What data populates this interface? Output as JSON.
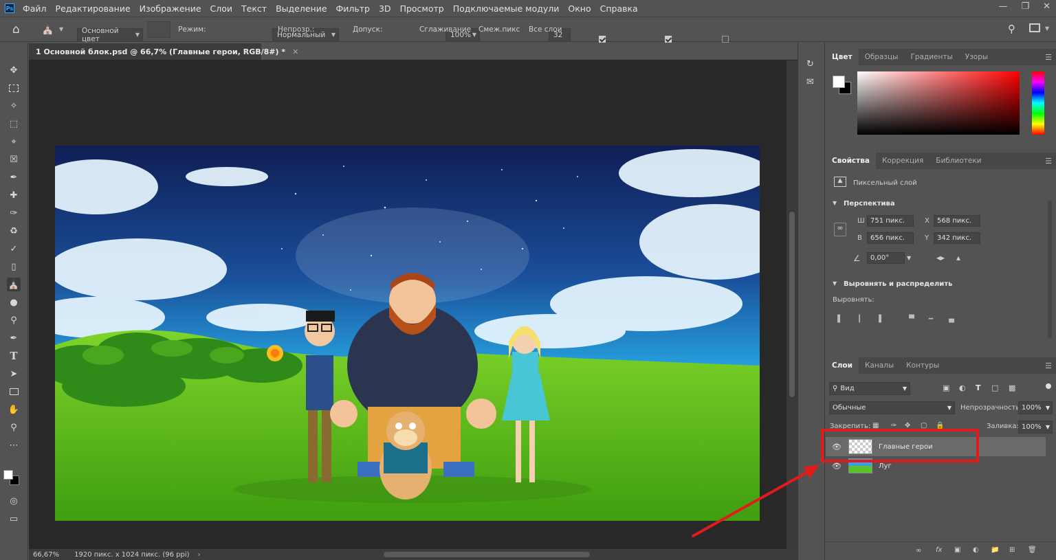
{
  "menu": {
    "app_logo": "Ps",
    "items": [
      "Файл",
      "Редактирование",
      "Изображение",
      "Слои",
      "Текст",
      "Выделение",
      "Фильтр",
      "3D",
      "Просмотр",
      "Подключаемые модули",
      "Окно",
      "Справка"
    ]
  },
  "options": {
    "source": "Основной цвет",
    "mode_label": "Режим:",
    "mode_value": "Нормальный",
    "opacity_label": "Непрозр.:",
    "opacity_value": "100%",
    "tolerance_label": "Допуск:",
    "tolerance_value": "32",
    "antialias_label": "Сглаживание",
    "antialias_checked": true,
    "contiguous_label": "Смеж.пикс",
    "contiguous_checked": true,
    "all_layers_label": "Все слои",
    "all_layers_checked": false
  },
  "document": {
    "tab_title": "1 Основной блок.psd @ 66,7% (Главные герои, RGB/8#) *",
    "status_zoom": "66,67%",
    "status_info": "1920 пикс. x 1024 пикс. (96 ppi)"
  },
  "color_panel": {
    "tabs": [
      "Цвет",
      "Образцы",
      "Градиенты",
      "Узоры"
    ],
    "active_tab": "Цвет",
    "foreground": "#ffffff",
    "background": "#000000"
  },
  "properties_panel": {
    "tabs": [
      "Свойства",
      "Коррекция",
      "Библиотеки"
    ],
    "active_tab": "Свойства",
    "layer_kind": "Пиксельный слой",
    "section_transform": "Перспектива",
    "w_label": "Ш",
    "w_value": "751 пикс.",
    "h_label": "В",
    "h_value": "656 пикс.",
    "x_label": "X",
    "x_value": "568 пикс.",
    "y_label": "Y",
    "y_value": "342 пикс.",
    "angle_value": "0,00°",
    "section_align": "Выровнять и распределить",
    "align_label": "Выровнять:"
  },
  "layers_panel": {
    "tabs": [
      "Слои",
      "Каналы",
      "Контуры"
    ],
    "active_tab": "Слои",
    "filter_placeholder": "Вид",
    "blend_mode": "Обычные",
    "opacity_label": "Непрозрачность:",
    "opacity_value": "100%",
    "lock_label": "Закрепить:",
    "fill_label": "Заливка:",
    "fill_value": "100%",
    "layers": [
      {
        "name": "Главные герои",
        "selected": true
      },
      {
        "name": "Луг",
        "selected": false
      }
    ]
  },
  "annotation": {
    "highlight_color": "#e11b1b"
  }
}
